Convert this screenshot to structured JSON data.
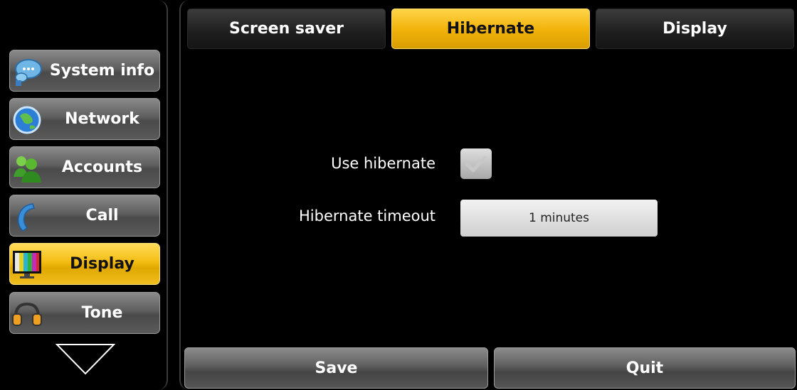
{
  "sidebar": {
    "items": [
      {
        "label": "System info",
        "icon": "chat-bubble-icon",
        "active": false
      },
      {
        "label": "Network",
        "icon": "globe-icon",
        "active": false
      },
      {
        "label": "Accounts",
        "icon": "users-icon",
        "active": false
      },
      {
        "label": "Call",
        "icon": "phone-handset-icon",
        "active": false
      },
      {
        "label": "Display",
        "icon": "monitor-icon",
        "active": true
      },
      {
        "label": "Tone",
        "icon": "headphones-icon",
        "active": false
      }
    ],
    "scroll_icon": "triangle-down-icon"
  },
  "tabs": [
    {
      "label": "Screen saver",
      "active": false
    },
    {
      "label": "Hibernate",
      "active": true
    },
    {
      "label": "Display",
      "active": false
    }
  ],
  "form": {
    "use_hibernate_label": "Use hibernate",
    "use_hibernate_checked": true,
    "timeout_label": "Hibernate timeout",
    "timeout_value": "1 minutes"
  },
  "buttons": {
    "save_label": "Save",
    "quit_label": "Quit"
  },
  "colors": {
    "active_accent": "#f4bd14",
    "background": "#000000"
  }
}
